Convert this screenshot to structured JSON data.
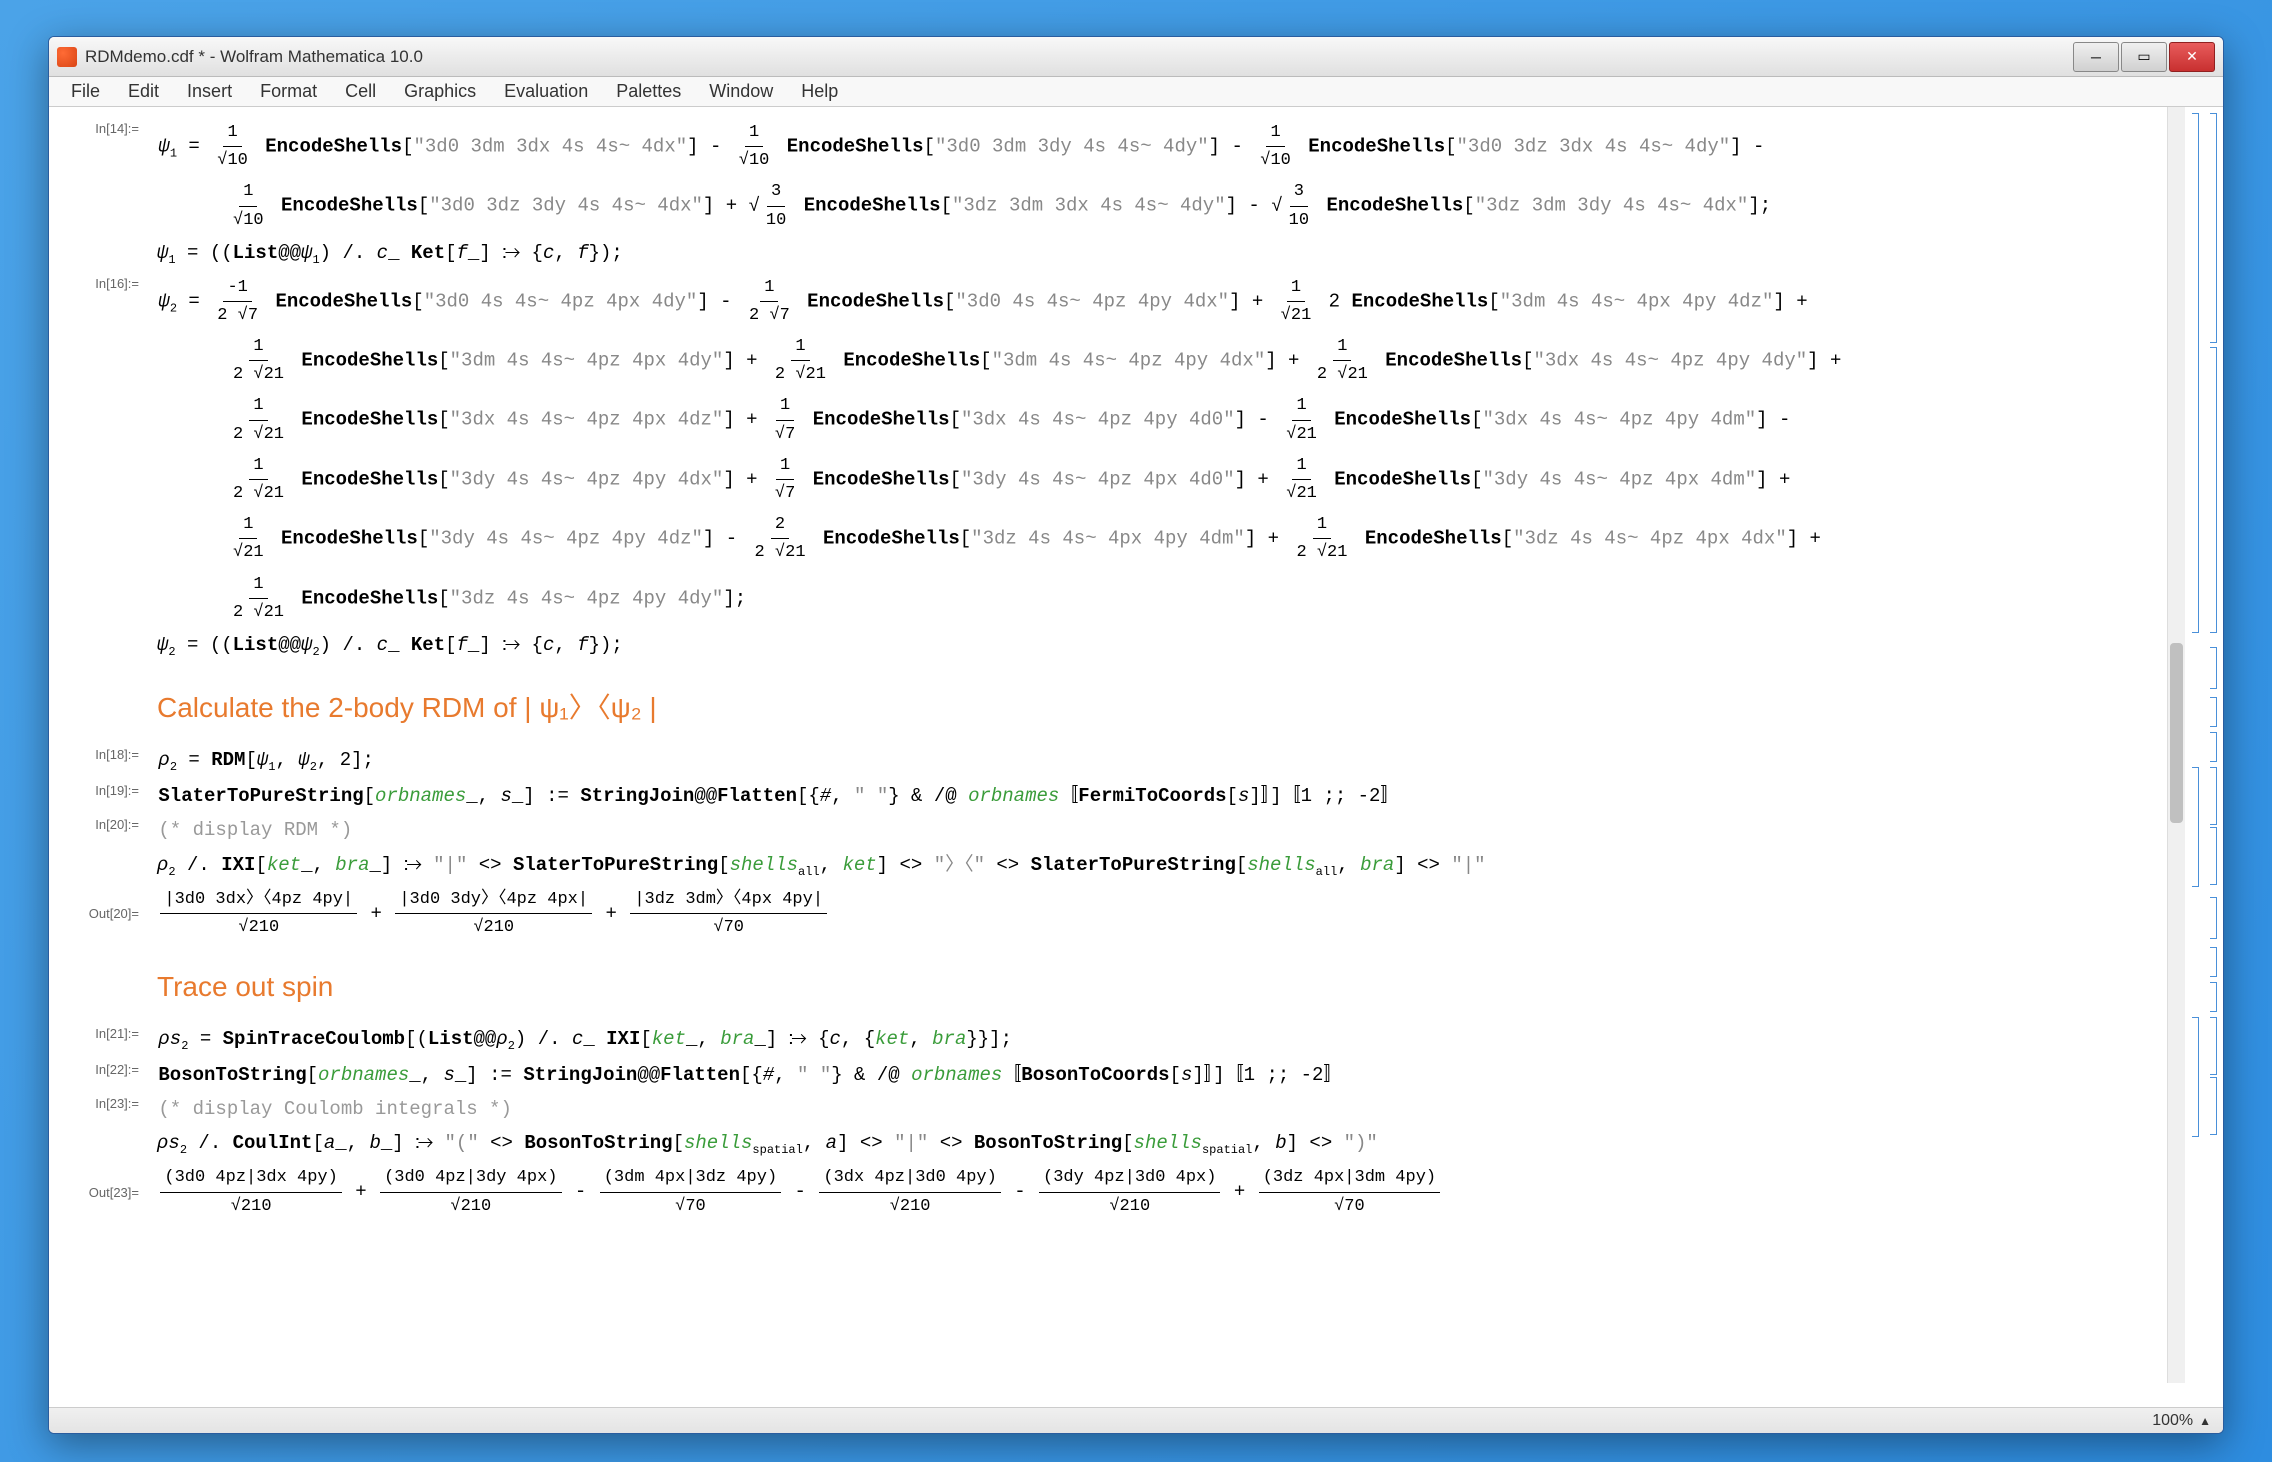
{
  "window": {
    "title": "RDMdemo.cdf * - Wolfram Mathematica 10.0"
  },
  "menu": [
    "File",
    "Edit",
    "Insert",
    "Format",
    "Cell",
    "Graphics",
    "Evaluation",
    "Palettes",
    "Window",
    "Help"
  ],
  "status": {
    "zoom": "100%"
  },
  "labels": {
    "in14": "In[14]:=",
    "in18": "In[18]:=",
    "in19": "In[19]:=",
    "in20": "In[20]:=",
    "out20": "Out[20]=",
    "in21": "In[21]:=",
    "in22": "In[22]:=",
    "in23": "In[23]:=",
    "out23": "Out[23]="
  },
  "headings": {
    "h1": "Calculate the 2-body RDM of  | ψ₁〉〈ψ₂ |",
    "h2": "Trace out spin"
  },
  "psi1_terms": [
    {
      "coef": "1/√10",
      "shells": "3d0 3dm 3dx 4s 4s~ 4dx",
      "sign": ""
    },
    {
      "coef": "1/√10",
      "shells": "3d0 3dm 3dy 4s 4s~ 4dy",
      "sign": "-"
    },
    {
      "coef": "1/√10",
      "shells": "3d0 3dz 3dx 4s 4s~ 4dy",
      "sign": "-"
    },
    {
      "coef": "1/√10",
      "shells": "3d0 3dz 3dy 4s 4s~ 4dx",
      "sign": "-"
    },
    {
      "coef": "√(3/10)",
      "shells": "3dz 3dm 3dx 4s 4s~ 4dy",
      "sign": "+"
    },
    {
      "coef": "√(3/10)",
      "shells": "3dz 3dm 3dy 4s 4s~ 4dx",
      "sign": "-"
    }
  ],
  "psi1_trans": "ψ₁ = ((List@@ψ₁) /. c_ Ket[f_] ⧴ {c, f});",
  "psi2_terms": [
    {
      "coef": "-1/(2√7)",
      "shells": "3d0 4s 4s~ 4pz 4px 4dy",
      "sign": ""
    },
    {
      "coef": "1/(2√7)",
      "shells": "3d0 4s 4s~ 4pz 4py 4dx",
      "sign": "-"
    },
    {
      "coef": "1/√21",
      "shells": "3dm 4s 4s~ 4px 4py 4dz",
      "op": "2",
      "sign": "+"
    },
    {
      "coef": "1/(2√21)",
      "shells": "3dm 4s 4s~ 4pz 4px 4dy",
      "sign": "+"
    },
    {
      "coef": "1/(2√21)",
      "shells": "3dm 4s 4s~ 4pz 4py 4dx",
      "sign": "+"
    },
    {
      "coef": "1/(2√21)",
      "shells": "3dx 4s 4s~ 4pz 4py 4dy",
      "sign": "+"
    },
    {
      "coef": "1/(2√21)",
      "shells": "3dx 4s 4s~ 4pz 4px 4dz",
      "sign": "+"
    },
    {
      "coef": "1/√7",
      "shells": "3dx 4s 4s~ 4pz 4py 4d0",
      "sign": "+"
    },
    {
      "coef": "1/√21",
      "shells": "3dx 4s 4s~ 4pz 4py 4dm",
      "sign": "-"
    },
    {
      "coef": "1/(2√21)",
      "shells": "3dy 4s 4s~ 4pz 4py 4dx",
      "sign": "-"
    },
    {
      "coef": "1/√7",
      "shells": "3dy 4s 4s~ 4pz 4px 4d0",
      "sign": "+"
    },
    {
      "coef": "1/√21",
      "shells": "3dy 4s 4s~ 4pz 4px 4dm",
      "sign": "+"
    },
    {
      "coef": "1/√21",
      "shells": "3dy 4s 4s~ 4pz 4py 4dz",
      "sign": "+"
    },
    {
      "coef": "2/(2√21)",
      "shells": "3dz 4s 4s~ 4px 4py 4dm",
      "sign": "-"
    },
    {
      "coef": "1/(2√21)",
      "shells": "3dz 4s 4s~ 4pz 4px 4dx",
      "sign": "+"
    },
    {
      "coef": "1/(2√21)",
      "shells": "3dz 4s 4s~ 4pz 4py 4dy",
      "sign": "+"
    }
  ],
  "psi2_trans": "ψ₂ = ((List@@ψ₂) /. c_ Ket[f_] ⧴ {c, f});",
  "rdm": {
    "rho2_def": "ρ₂ = RDM[ψ₁, ψ₂, 2];",
    "slater_def_pre": "SlaterToPureString[",
    "slater_args": "orbnames_, s_",
    "slater_def_post": "] := StringJoin@@Flatten[{#, \"  \"} & /@ orbnames〚FermiToCoords[s]〛]〚1 ;; -2〛",
    "display_comment": "(* display RDM *)",
    "rho2_disp": "ρ₂ /. IXI[ket_, bra_] ⧴ \"|\" <> SlaterToPureString[shellsₐₗₗ, ket] <> \"〉〈\" <> SlaterToPureString[shellsₐₗₗ, bra] <> \"|\""
  },
  "rdm_output": [
    {
      "num": "|3d0 3dx〉〈4pz 4py|",
      "den": "√210",
      "sign": ""
    },
    {
      "num": "|3d0 3dy〉〈4pz 4px|",
      "den": "√210",
      "sign": "+"
    },
    {
      "num": "|3dz 3dm〉〈4px 4py|",
      "den": "√70",
      "sign": "+"
    }
  ],
  "trace": {
    "rhoS2_def": "ρs₂ = SpinTraceCoulomb[(List@@ρ₂) /. c_ IXI[ket_, bra_] ⧴ {c, {ket, bra}}];",
    "boson_def_pre": "BosonToString[",
    "boson_args": "orbnames_, s_",
    "boson_def_post": "] := StringJoin@@Flatten[{#, \"  \"} & /@ orbnames〚BosonToCoords[s]〛]〚1 ;; -2〛",
    "display_comment": "(* display Coulomb integrals *)",
    "rhoS2_disp": "ρs₂ /. CoulInt[a_, b_] ⧴ \"(\" <> BosonToString[shellsₛₚₐₜᵢₐₗ, a] <> \"|\" <> BosonToString[shellsₛₚₐₜᵢₐₗ, b] <> \")\""
  },
  "coul_output": [
    {
      "num": "(3d0 4pz|3dx 4py)",
      "den": "√210",
      "sign": ""
    },
    {
      "num": "(3d0 4pz|3dy 4px)",
      "den": "√210",
      "sign": "+"
    },
    {
      "num": "(3dm 4px|3dz 4py)",
      "den": "√70",
      "sign": "-"
    },
    {
      "num": "(3dx 4pz|3d0 4py)",
      "den": "√210",
      "sign": "-"
    },
    {
      "num": "(3dy 4pz|3d0 4px)",
      "den": "√210",
      "sign": "-"
    },
    {
      "num": "(3dz 4px|3dm 4py)",
      "den": "√70",
      "sign": "+"
    }
  ]
}
